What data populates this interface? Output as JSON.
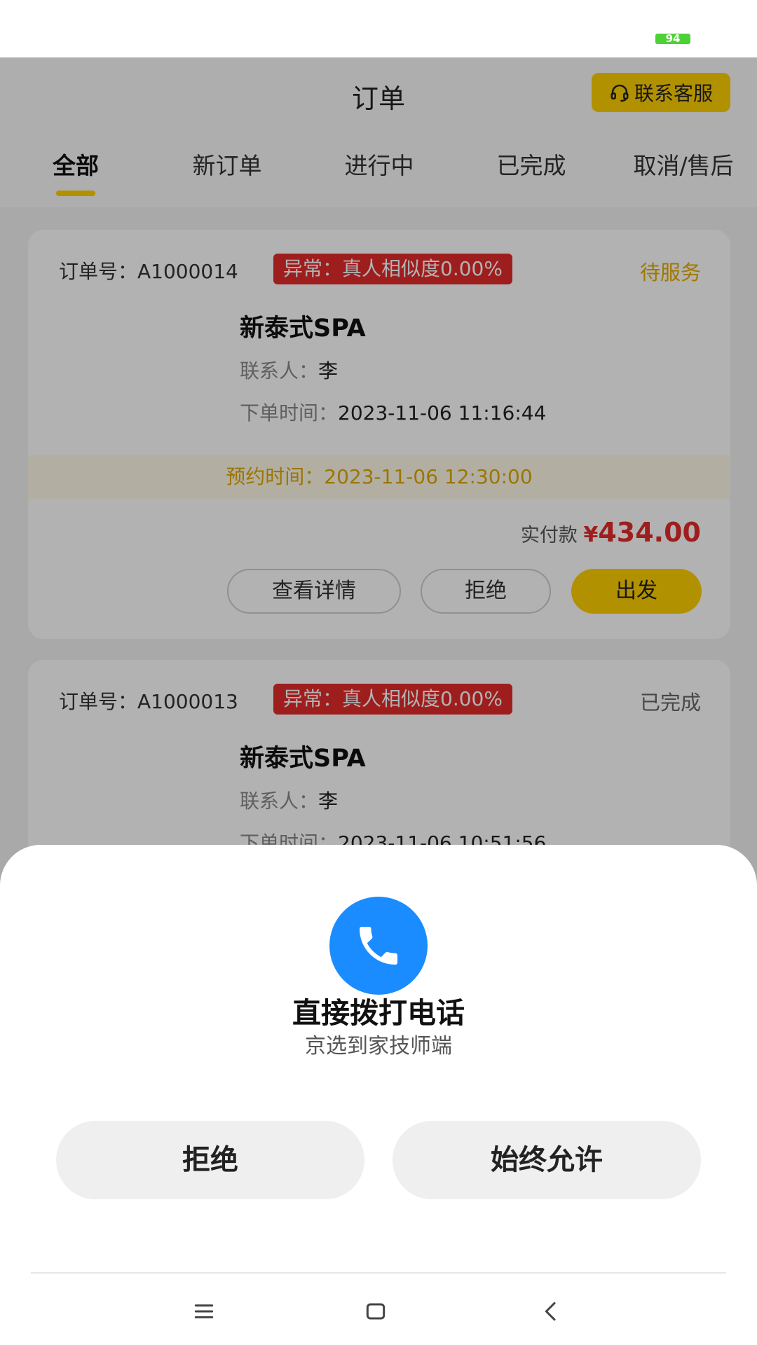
{
  "status_bar": {
    "battery": "94",
    "battery_color": "#4cd137"
  },
  "header": {
    "title": "订单",
    "customer_service": "联系客服",
    "tabs": [
      "全部",
      "新订单",
      "进行中",
      "已完成",
      "取消/售后"
    ],
    "active_tab": "全部"
  },
  "orders": [
    {
      "order_no_label": "订单号：A1000014",
      "alert": "异常：真人相似度0.00%",
      "status": "待服务",
      "service": "新泰式SPA",
      "contact_label": "联系人：",
      "contact": "李",
      "order_time_label": "下单时间：",
      "order_time": "2023-11-06 11:16:44",
      "appointment": "预约时间：2023-11-06 12:30:00",
      "paid_label": "实付款",
      "currency": "¥",
      "amount": "434.00",
      "buttons": {
        "details": "查看详情",
        "reject": "拒绝",
        "depart": "出发"
      }
    },
    {
      "order_no_label": "订单号：A1000013",
      "alert": "异常：真人相似度0.00%",
      "status": "已完成",
      "service": "新泰式SPA",
      "contact_label": "联系人：",
      "contact": "李",
      "order_time_label": "下单时间：",
      "order_time": "2023-11-06 10:51:56"
    }
  ],
  "permission_sheet": {
    "icon": "phone-icon",
    "title": "直接拨打电话",
    "subtitle": "京选到家技师端",
    "deny": "拒绝",
    "always_allow": "始终允许"
  },
  "colors": {
    "accent": "#ffd000",
    "alert": "#e32b2b",
    "phone_icon_bg": "#1a8cff"
  },
  "nav_bar": [
    "menu-icon",
    "home-icon",
    "back-icon"
  ]
}
